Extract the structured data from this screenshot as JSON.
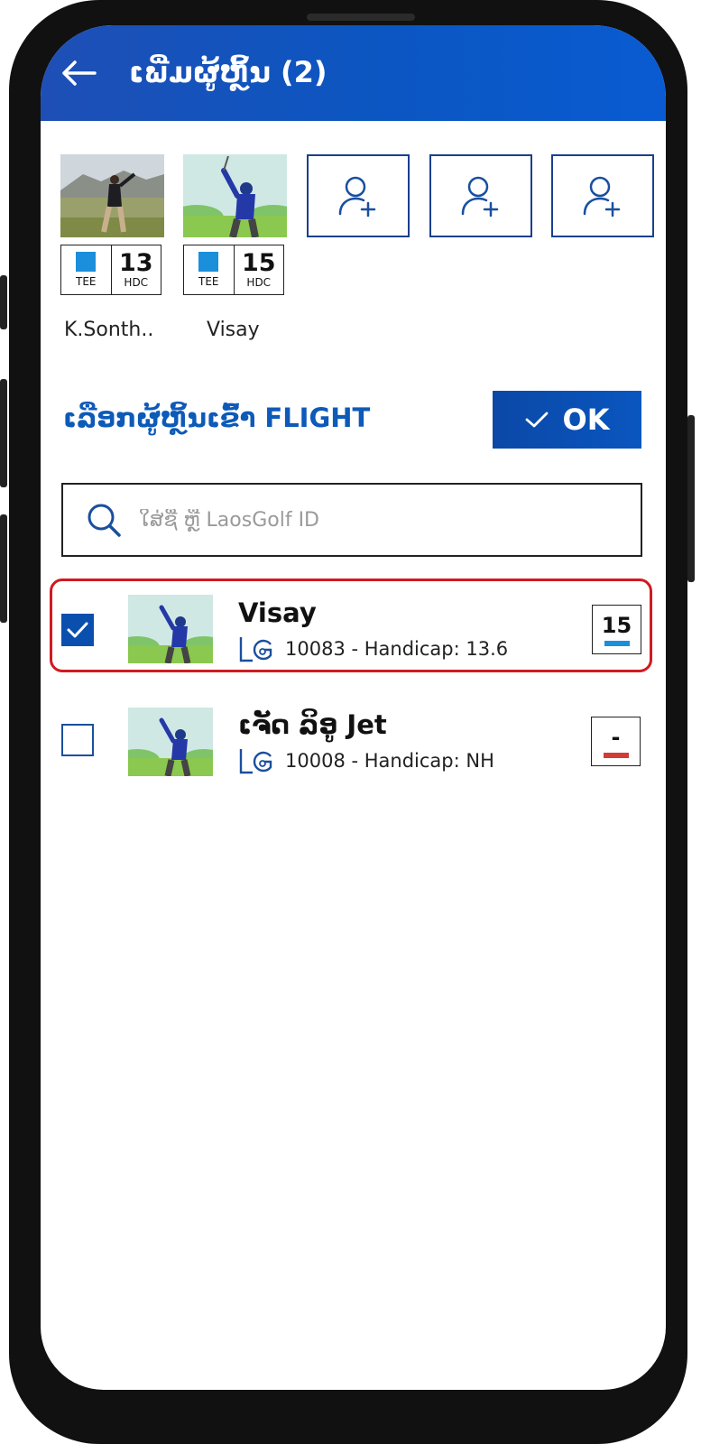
{
  "header": {
    "title": "ເພີ່ມຜູ້ຫຼິ້ນ (2)"
  },
  "colors": {
    "brand_blue": "#0b56c2",
    "tee_blue": "#1b8fdc",
    "selected_border": "#d01a20",
    "nh_red": "#d33b36"
  },
  "slots": [
    {
      "name": "K.Sonth..",
      "tee_label": "TEE",
      "hdc_value": "13",
      "hdc_label": "HDC",
      "photo": "golfer-course-photo"
    },
    {
      "name": "Visay",
      "tee_label": "TEE",
      "hdc_value": "15",
      "hdc_label": "HDC",
      "photo": "golfer-illustration"
    }
  ],
  "add_slots": [
    "add-player-icon",
    "add-player-icon",
    "add-player-icon"
  ],
  "section": {
    "title": "ເລືອກຜູ້ຫຼິ້ນເຂົ້າ FLIGHT",
    "ok_label": "OK"
  },
  "search": {
    "placeholder": "ໃສ່ຊື່ ຫຼື LaosGolf ID",
    "value": ""
  },
  "players": [
    {
      "name": "Visay",
      "id_line": "10083 - Handicap: 13.6",
      "hdc": "15",
      "checked": true,
      "bar_color": "#1b8fdc"
    },
    {
      "name": "ເຈັດ ລິອູ Jet",
      "id_line": "10008 - Handicap: NH",
      "hdc": "-",
      "checked": false,
      "bar_color": "#d33b36"
    }
  ]
}
